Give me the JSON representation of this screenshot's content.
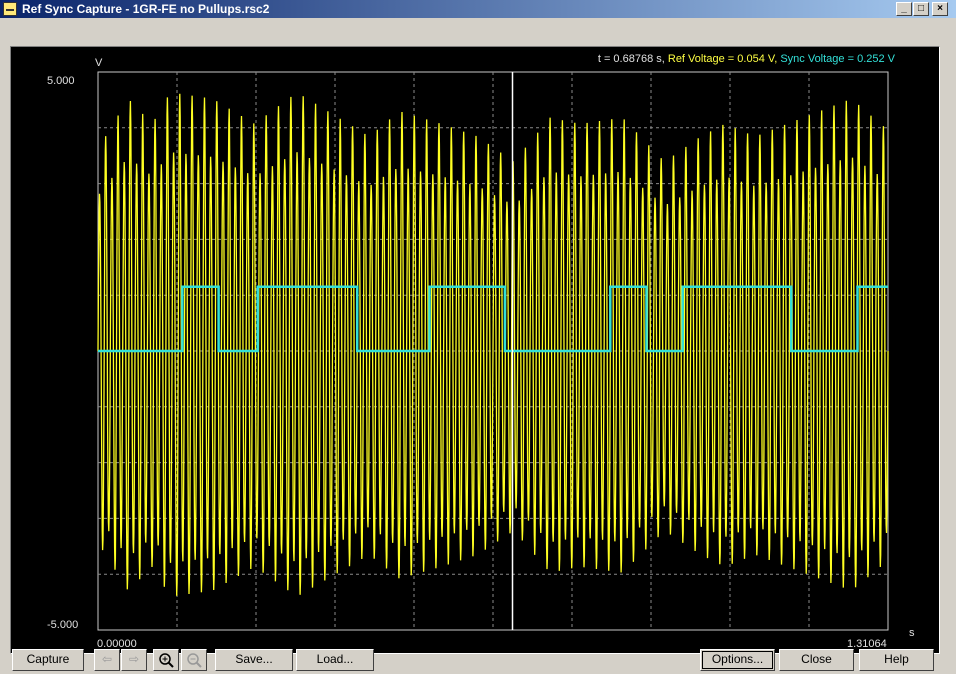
{
  "window": {
    "title": "Ref Sync Capture - 1GR-FE no Pullups.rsc2",
    "controls": [
      "_",
      "□",
      "×"
    ]
  },
  "plot": {
    "y_unit": "V",
    "y_max_label": "5.000",
    "y_min_label": "-5.000",
    "x_unit": "s",
    "x_min_label": "0.00000",
    "x_max_label": "1.31064",
    "readout": {
      "t_text": "t = 0.68768 s,",
      "ref_text": "Ref Voltage = 0.054 V,",
      "sync_text": "Sync Voltage = 0.252 V"
    },
    "colors": {
      "background": "#000000",
      "grid": "#8a8a8a",
      "ref": "#ffff22",
      "sync": "#33e0d8",
      "cursor": "#ffffff"
    }
  },
  "chart_data": {
    "type": "line",
    "x_unit": "s",
    "y_unit": "V",
    "xlim": [
      0.0,
      1.31064
    ],
    "ylim": [
      -5.0,
      5.0
    ],
    "grid": true,
    "cursor_x": 0.68768,
    "series": [
      {
        "name": "Ref Voltage",
        "kind": "oscillation",
        "cycles": 128,
        "envelope": [
          [
            0.0,
            3.2
          ],
          [
            0.05,
            4.0
          ],
          [
            0.09,
            3.6
          ],
          [
            0.12,
            4.1
          ],
          [
            0.19,
            4.0
          ],
          [
            0.26,
            3.6
          ],
          [
            0.33,
            4.1
          ],
          [
            0.45,
            3.4
          ],
          [
            0.5,
            3.8
          ],
          [
            0.57,
            3.6
          ],
          [
            0.63,
            3.4
          ],
          [
            0.69,
            3.0
          ],
          [
            0.75,
            3.7
          ],
          [
            0.8,
            3.6
          ],
          [
            0.87,
            3.7
          ],
          [
            0.94,
            3.0
          ],
          [
            1.0,
            3.4
          ],
          [
            1.04,
            3.6
          ],
          [
            1.09,
            3.4
          ],
          [
            1.17,
            3.7
          ],
          [
            1.25,
            4.0
          ],
          [
            1.31064,
            3.5
          ]
        ]
      },
      {
        "name": "Sync Voltage",
        "kind": "step",
        "points": [
          [
            0.0,
            0.0
          ],
          [
            0.14,
            0.0
          ],
          [
            0.14,
            1.15
          ],
          [
            0.2,
            1.15
          ],
          [
            0.2,
            0.0
          ],
          [
            0.265,
            0.0
          ],
          [
            0.265,
            1.15
          ],
          [
            0.43,
            1.15
          ],
          [
            0.43,
            0.0
          ],
          [
            0.55,
            0.0
          ],
          [
            0.55,
            1.15
          ],
          [
            0.675,
            1.15
          ],
          [
            0.675,
            0.0
          ],
          [
            0.85,
            0.0
          ],
          [
            0.85,
            1.15
          ],
          [
            0.91,
            1.15
          ],
          [
            0.91,
            0.0
          ],
          [
            0.97,
            0.0
          ],
          [
            0.97,
            1.15
          ],
          [
            1.15,
            1.15
          ],
          [
            1.15,
            0.0
          ],
          [
            1.26,
            0.0
          ],
          [
            1.26,
            1.15
          ],
          [
            1.31064,
            1.15
          ]
        ]
      }
    ]
  },
  "toolbar": {
    "capture_label": "Capture",
    "back_icon": "arrow-left-icon",
    "forward_icon": "arrow-right-icon",
    "zoom_in_icon": "zoom-in-icon",
    "zoom_out_icon": "zoom-out-icon",
    "save_label": "Save...",
    "load_label": "Load...",
    "options_label": "Options...",
    "close_label": "Close",
    "help_label": "Help"
  }
}
